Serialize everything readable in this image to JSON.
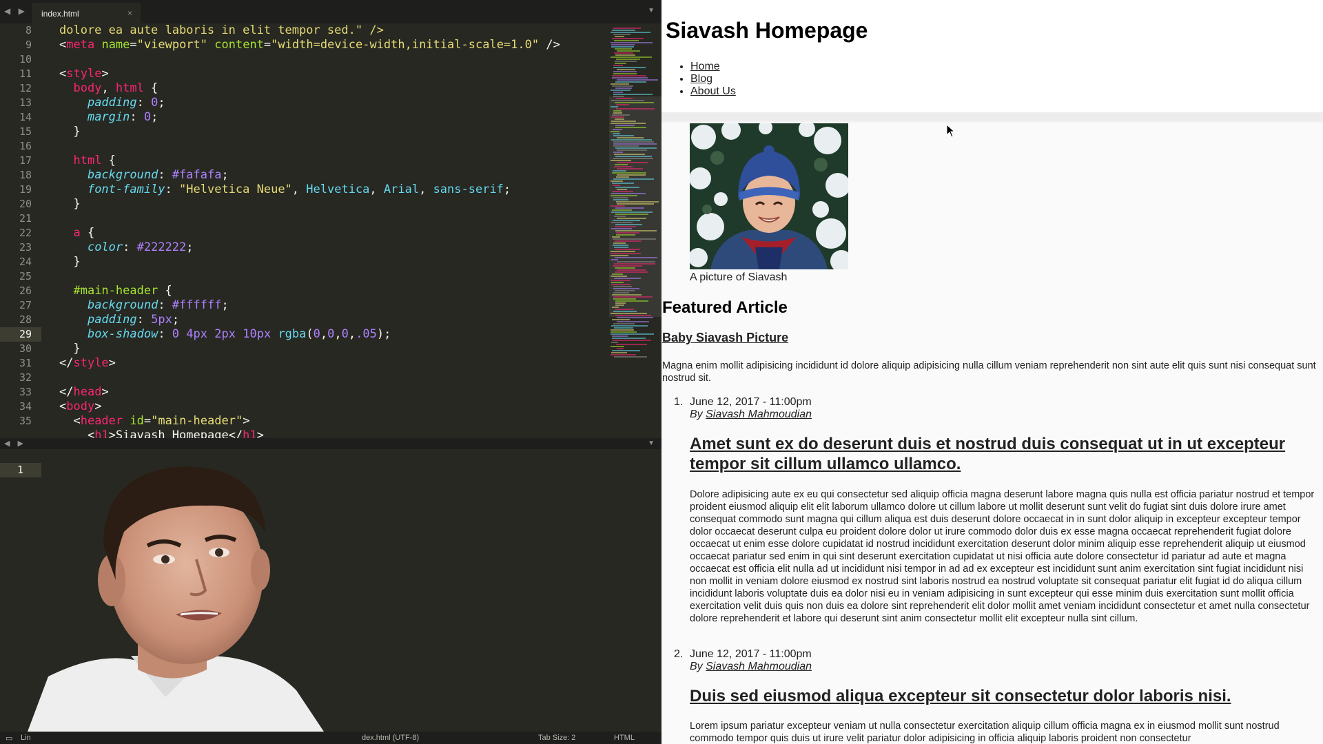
{
  "editor": {
    "tab_title": "index.html",
    "nav_arrows": "◀ ▶",
    "tab_close": "×",
    "pane_menu": "▼",
    "lines": [
      {
        "n": "8"
      },
      {
        "n": "9"
      },
      {
        "n": "10"
      },
      {
        "n": "11"
      },
      {
        "n": "12"
      },
      {
        "n": "13"
      },
      {
        "n": "14"
      },
      {
        "n": "15"
      },
      {
        "n": "16"
      },
      {
        "n": "17"
      },
      {
        "n": "18"
      },
      {
        "n": "19"
      },
      {
        "n": "20"
      },
      {
        "n": "21"
      },
      {
        "n": "22"
      },
      {
        "n": "23"
      },
      {
        "n": "24"
      },
      {
        "n": "25"
      },
      {
        "n": "26"
      },
      {
        "n": "27"
      },
      {
        "n": "28"
      },
      {
        "n": "29"
      },
      {
        "n": "30"
      },
      {
        "n": "31"
      },
      {
        "n": "32"
      },
      {
        "n": "33"
      },
      {
        "n": "34"
      },
      {
        "n": "35"
      }
    ],
    "code": {
      "l7": "dolore ea aute laboris in elit tempor sed.\" />",
      "l8_tag": "meta",
      "l8_a1": "name",
      "l8_v1": "\"viewport\"",
      "l8_a2": "content",
      "l8_v2": "\"width=device-width,initial-scale=1.0\"",
      "style_tag": "style",
      "body_sel": "body",
      "html_sel": "html",
      "padding": "padding",
      "margin": "margin",
      "zero": "0",
      "background": "background",
      "bg_val": "#fafafa",
      "font_family": "font-family",
      "font_str": "\"Helvetica Neue\"",
      "font_h": "Helvetica",
      "font_a": "Arial",
      "font_s": "sans-serif",
      "a_sel": "a",
      "color": "color",
      "color_val": "#222222",
      "main_header_sel": "#main-header",
      "white_val": "#ffffff",
      "pad_val": "5px",
      "box_shadow": "box-shadow",
      "bs_0": "0",
      "bs_4": "4px",
      "bs_2": "2px",
      "bs_10": "10px",
      "rgba": "rgba",
      "rgba_args_0": "0",
      "rgba_alpha": ".05",
      "head_tag": "head",
      "body_tag": "body",
      "header_tag": "header",
      "id_attr": "id",
      "id_val": "\"main-header\"",
      "h1_text": "Siavash Homepage",
      "h1_tag": "h1"
    },
    "lower_line": "1"
  },
  "statusbar": {
    "left": "Lin",
    "encoding": "dex.html (UTF-8)",
    "tab_size": "Tab Size: 2",
    "syntax": "HTML"
  },
  "preview": {
    "site_title": "Siavash Homepage",
    "nav": [
      "Home",
      "Blog",
      "About Us"
    ],
    "photo_caption": "A picture of Siavash",
    "featured_heading": "Featured Article",
    "featured_link": "Baby Siavash Picture",
    "featured_text": "Magna enim mollit adipisicing incididunt id dolore aliquip adipisicing nulla cillum veniam reprehenderit non sint aute elit quis sunt nisi consequat sunt nostrud sit.",
    "posts": [
      {
        "num": "1.",
        "date": "June 12, 2017 - 11:00pm",
        "by": "By",
        "author": "Siavash Mahmoudian",
        "title": "Amet sunt ex do deserunt duis et nostrud duis consequat ut in ut excepteur tempor sit cillum ullamco ullamco.",
        "body": "Dolore adipisicing aute ex eu qui consectetur sed aliquip officia magna deserunt labore magna quis nulla est officia pariatur nostrud et tempor proident eiusmod aliquip elit elit laborum ullamco dolore ut cillum labore ut mollit deserunt sunt velit do fugiat sint duis dolore irure amet consequat commodo sunt magna qui cillum aliqua est duis deserunt dolore occaecat in in sunt dolor aliquip in excepteur excepteur tempor dolor occaecat deserunt culpa eu proident dolore dolor ut irure commodo dolor duis ex esse magna occaecat reprehenderit fugiat dolore occaecat ut enim esse dolore cupidatat id nostrud incididunt exercitation deserunt dolor minim aliquip esse reprehenderit aliquip ut eiusmod occaecat pariatur sed enim in qui sint deserunt exercitation cupidatat ut nisi officia aute dolore consectetur id pariatur ad aute et magna occaecat est officia elit nulla ad ut incididunt nisi tempor in ad ad ex excepteur est incididunt sunt anim exercitation sint fugiat incididunt nisi non mollit in veniam dolore eiusmod ex nostrud sint laboris nostrud ea nostrud voluptate sit consequat pariatur elit fugiat id do aliqua cillum incididunt laboris voluptate duis ea dolor nisi eu in veniam adipisicing in sunt excepteur qui esse minim duis exercitation sunt mollit officia exercitation velit duis quis non duis ea dolore sint reprehenderit elit dolor mollit amet veniam incididunt consectetur et amet nulla consectetur dolore reprehenderit et labore qui deserunt sint anim consectetur mollit elit excepteur nulla sint cillum."
      },
      {
        "num": "2.",
        "date": "June 12, 2017 - 11:00pm",
        "by": "By",
        "author": "Siavash Mahmoudian",
        "title": "Duis sed eiusmod aliqua excepteur sit consectetur dolor laboris nisi.",
        "body": "Lorem ipsum pariatur excepteur veniam ut nulla consectetur exercitation aliquip cillum officia magna ex in eiusmod mollit sunt nostrud commodo tempor quis duis ut irure velit pariatur dolor adipisicing in officia aliquip laboris proident non consectetur"
      }
    ]
  },
  "colors": {
    "editor_bg": "#272822",
    "editor_chrome": "#1e1f1c",
    "tag": "#f92672",
    "attr": "#a6e22e",
    "string": "#e6db74",
    "property": "#66d9ef",
    "number": "#ae81ff",
    "page_bg": "#fafafa",
    "header_bg": "#ffffff",
    "link": "#222222"
  }
}
